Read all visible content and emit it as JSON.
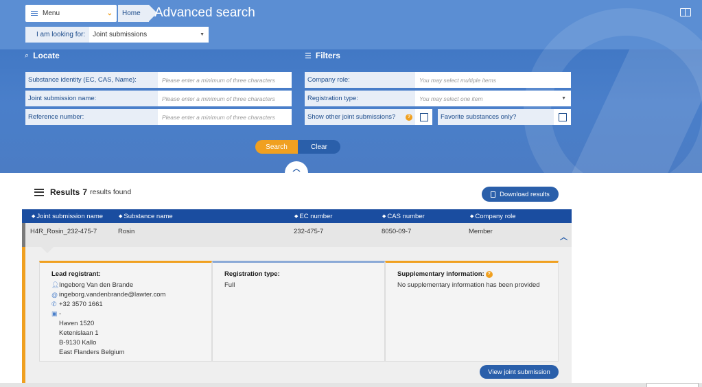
{
  "header": {
    "menu_label": "Menu",
    "breadcrumb_home": "Home",
    "title": "Advanced search"
  },
  "looking_for": {
    "label": "I am looking for:",
    "value": "Joint submissions"
  },
  "locate": {
    "heading": "Locate",
    "fields": [
      {
        "label": "Substance identity (EC, CAS, Name):",
        "placeholder": "Please enter a minimum of three characters"
      },
      {
        "label": "Joint submission name:",
        "placeholder": "Please enter a minimum of three characters"
      },
      {
        "label": "Reference number:",
        "placeholder": "Please enter a minimum of three characters"
      }
    ]
  },
  "filters": {
    "heading": "Filters",
    "company_role": {
      "label": "Company role:",
      "placeholder": "You may select multiple items"
    },
    "registration_type": {
      "label": "Registration type:",
      "placeholder": "You may select one item"
    },
    "show_other": {
      "label": "Show other joint submissions?",
      "help": "?",
      "checked": false
    },
    "favorite": {
      "label": "Favorite substances only?",
      "checked": false
    }
  },
  "actions": {
    "search": "Search",
    "clear": "Clear"
  },
  "results": {
    "title": "Results",
    "count": "7",
    "found_text": "results found",
    "download_label": "Download results",
    "columns": [
      "Joint submission name",
      "Substance name",
      "EC number",
      "CAS number",
      "Company role"
    ],
    "rows": [
      {
        "joint_submission_name": "H4R_Rosin_232-475-7",
        "substance_name": "Rosin",
        "ec_number": "232-475-7",
        "cas_number": "8050-09-7",
        "company_role": "Member"
      }
    ]
  },
  "detail": {
    "lead_registrant": {
      "heading": "Lead registrant:",
      "name": "Ingeborg Van den Brande",
      "email": "ingeborg.vandenbrande@lawter.com",
      "phone": "+32 3570 1661",
      "org": "-",
      "address": [
        "Haven 1520",
        "Ketenislaan 1",
        "B-9130 Kallo",
        "East Flanders Belgium"
      ]
    },
    "registration_type": {
      "heading": "Registration type:",
      "value": "Full"
    },
    "supplementary": {
      "heading": "Supplementary information:",
      "help": "?",
      "value": "No supplementary information has been provided"
    },
    "view_button": "View joint submission"
  },
  "colors": {
    "accent_orange": "#f0a020",
    "primary_blue": "#2a5faa",
    "header_blue": "#4a7fca"
  },
  "icons": {
    "menu": "hamburger-icon",
    "search": "search-icon",
    "filters": "filter-icon",
    "results": "list-icon",
    "download": "document-icon",
    "person": "person-icon",
    "email": "at-icon",
    "phone": "phone-icon",
    "org": "briefcase-icon",
    "book": "book-icon"
  }
}
